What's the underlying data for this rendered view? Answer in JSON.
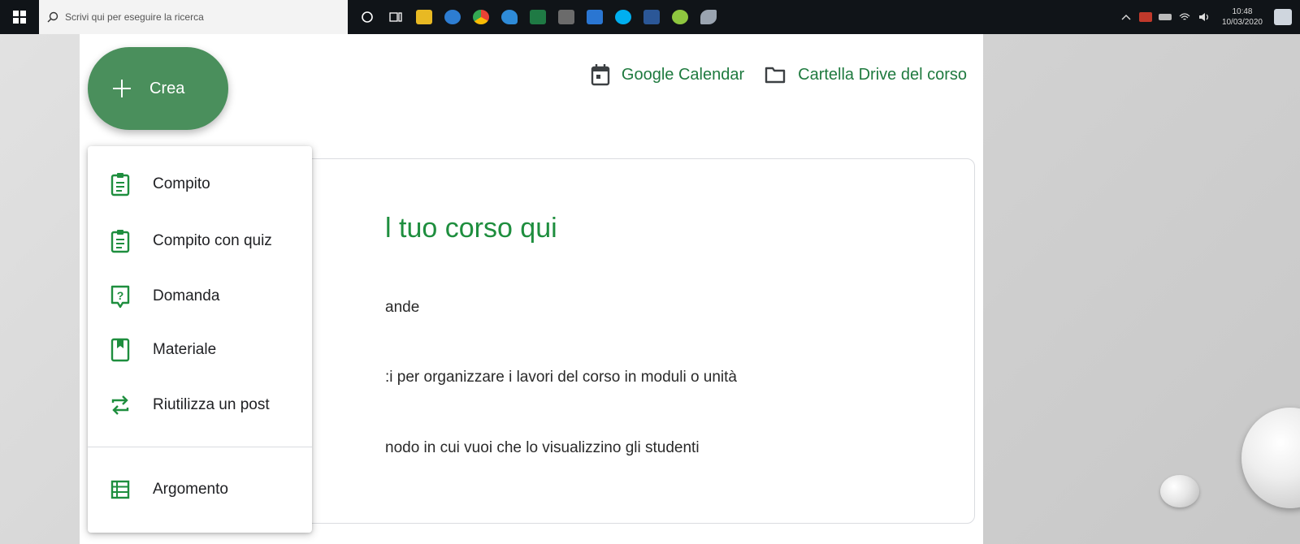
{
  "taskbar": {
    "search_placeholder": "Scrivi qui per eseguire la ricerca",
    "apps": [
      {
        "name": "cortana-icon",
        "color": "#ffffff"
      },
      {
        "name": "task-view-icon",
        "color": "#ffffff"
      },
      {
        "name": "file-explorer-icon",
        "color": "#e8b923"
      },
      {
        "name": "photos-icon",
        "color": "#2d7dd2"
      },
      {
        "name": "chrome-icon",
        "color": "#e94235"
      },
      {
        "name": "edge-icon",
        "color": "#2e8bd8"
      },
      {
        "name": "excel-icon",
        "color": "#1f7a44"
      },
      {
        "name": "calculator-icon",
        "color": "#6b6b6b"
      },
      {
        "name": "app-icon",
        "color": "#2a76d2"
      },
      {
        "name": "skype-icon",
        "color": "#00aff0"
      },
      {
        "name": "word-icon",
        "color": "#2b5797"
      },
      {
        "name": "chrome-apps-icon",
        "color": "#8ec63f"
      },
      {
        "name": "paint-icon",
        "color": "#9aa4b0"
      }
    ],
    "clock_time": "10:48",
    "clock_date": "10/03/2020"
  },
  "classroom": {
    "create_label": "Crea",
    "google_calendar_label": "Google Calendar",
    "drive_folder_label": "Cartella Drive del corso",
    "card": {
      "title": "l tuo corso qui",
      "lines": [
        "ande",
        ":i per organizzare i lavori del corso in moduli o unità",
        "nodo in cui vuoi che lo visualizzino gli studenti"
      ]
    },
    "menu": {
      "items": [
        {
          "label": "Compito",
          "icon": "assignment-icon"
        },
        {
          "label": "Compito con quiz",
          "icon": "quiz-assignment-icon"
        },
        {
          "label": "Domanda",
          "icon": "question-icon"
        },
        {
          "label": "Materiale",
          "icon": "material-icon"
        },
        {
          "label": "Riutilizza un post",
          "icon": "reuse-post-icon"
        },
        {
          "label": "Argomento",
          "icon": "topic-icon"
        }
      ]
    }
  },
  "colors": {
    "accent_green": "#1e8e3e",
    "create_button": "#4a8f5c",
    "taskbar": "#101418"
  }
}
